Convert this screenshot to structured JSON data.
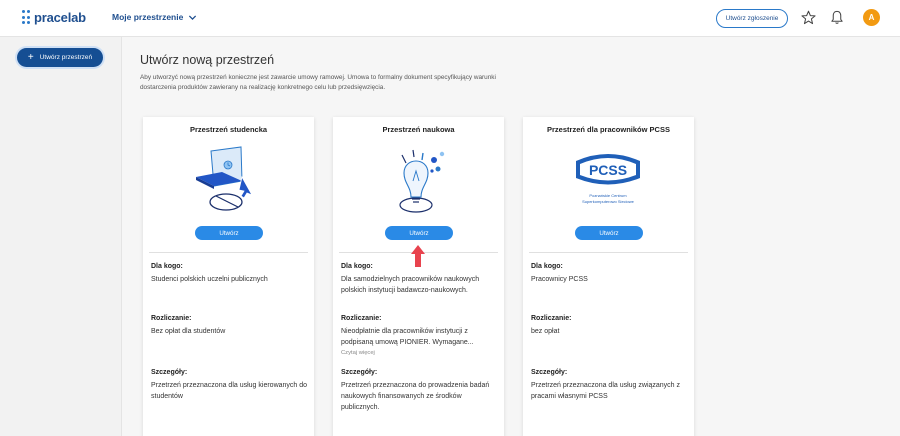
{
  "app": {
    "logo": "pracelab"
  },
  "header": {
    "workspace_menu": "Moje przestrzenie",
    "report_button": "Utwórz zgłoszenie",
    "avatar_initial": "A",
    "icons": [
      "star-icon",
      "bell-icon",
      "chevron-down-icon"
    ]
  },
  "sidebar": {
    "create_button": "Utwórz przestrzeń"
  },
  "main": {
    "title": "Utwórz nową przestrzeń",
    "description": "Aby utworzyć nową przestrzeń konieczne jest zawarcie umowy ramowej. Umowa to formalny dokument specyfikujący warunki dostarczenia produktów zawierany na realizację konkretnego celu lub przedsięwzięcia."
  },
  "cards": [
    {
      "title": "Przestrzeń studencka",
      "button": "Utwórz",
      "for_whom_label": "Dla kogo:",
      "for_whom": "Studenci polskich uczelni publicznych",
      "billing_label": "Rozliczanie:",
      "billing": "Bez opłat dla studentów",
      "details_label": "Szczegóły:",
      "details": "Przetrzeń przeznaczona dla usług kierowanych do studentów"
    },
    {
      "title": "Przestrzeń naukowa",
      "button": "Utwórz",
      "for_whom_label": "Dla kogo:",
      "for_whom": "Dla samodzielnych pracowników naukowych polskich instytucji badawczo-naukowych.",
      "billing_label": "Rozliczanie:",
      "billing": "Nieodpłatnie dla pracowników instytucji z podpisaną umową PIONIER. Wymagane...",
      "read_more": "Czytaj więcej",
      "details_label": "Szczegóły:",
      "details": "Przetrzeń przeznaczona do prowadzenia badań naukowych finansowanych ze środków publicznych."
    },
    {
      "title": "Przestrzeń dla pracowników PCSS",
      "button": "Utwórz",
      "logo_text": "PCSS",
      "logo_subtitle_1": "Poznańskie Centrum",
      "logo_subtitle_2": "Superkomputerowo Sieciowe",
      "for_whom_label": "Dla kogo:",
      "for_whom": "Pracownicy PCSS",
      "billing_label": "Rozliczanie:",
      "billing": "bez opłat",
      "details_label": "Szczegóły:",
      "details": "Przetrzeń przeznaczona dla usług związanych z pracami własnymi PCSS"
    }
  ],
  "colors": {
    "brand_dark": "#154e93",
    "brand": "#2a79c9",
    "button": "#2a8ae6",
    "avatar": "#f29a12",
    "arrow": "#e8434e"
  }
}
